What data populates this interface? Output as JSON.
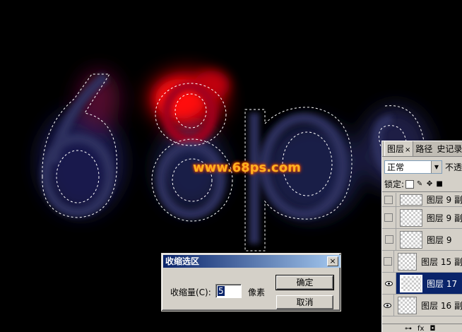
{
  "canvas": {
    "watermark": "www.68ps.com",
    "artwork_text": "68ps"
  },
  "layers_panel": {
    "tabs": [
      {
        "label": "图层",
        "close": "×"
      },
      {
        "label": "路径"
      },
      {
        "label": "史记录"
      }
    ],
    "blend_mode": "正常",
    "opacity_label": "不透",
    "lock_label": "锁定:",
    "layers": [
      {
        "name": "图层 9 副",
        "visible": false,
        "selected": false
      },
      {
        "name": "图层 9 副",
        "visible": false,
        "selected": false
      },
      {
        "name": "图层 9",
        "visible": false,
        "selected": false
      },
      {
        "name": "图层 15 副",
        "visible": false,
        "selected": false
      },
      {
        "name": "图层 17",
        "visible": true,
        "selected": true
      },
      {
        "name": "图层 16 副",
        "visible": true,
        "selected": false
      }
    ],
    "bottom_icons": [
      "link-icon",
      "fx-icon",
      "mask-icon"
    ],
    "bottom_fx": "fx"
  },
  "dialog": {
    "title": "收缩选区",
    "close_label": "×",
    "field_label": "收缩量(C):",
    "field_value": "5",
    "unit": "像素",
    "ok_label": "确定",
    "cancel_label": "取消"
  },
  "colors": {
    "glow_red": "#e00010",
    "glow_blue": "#2a2d5a",
    "watermark": "#ffb020",
    "selection_bg": "#0a246a"
  }
}
